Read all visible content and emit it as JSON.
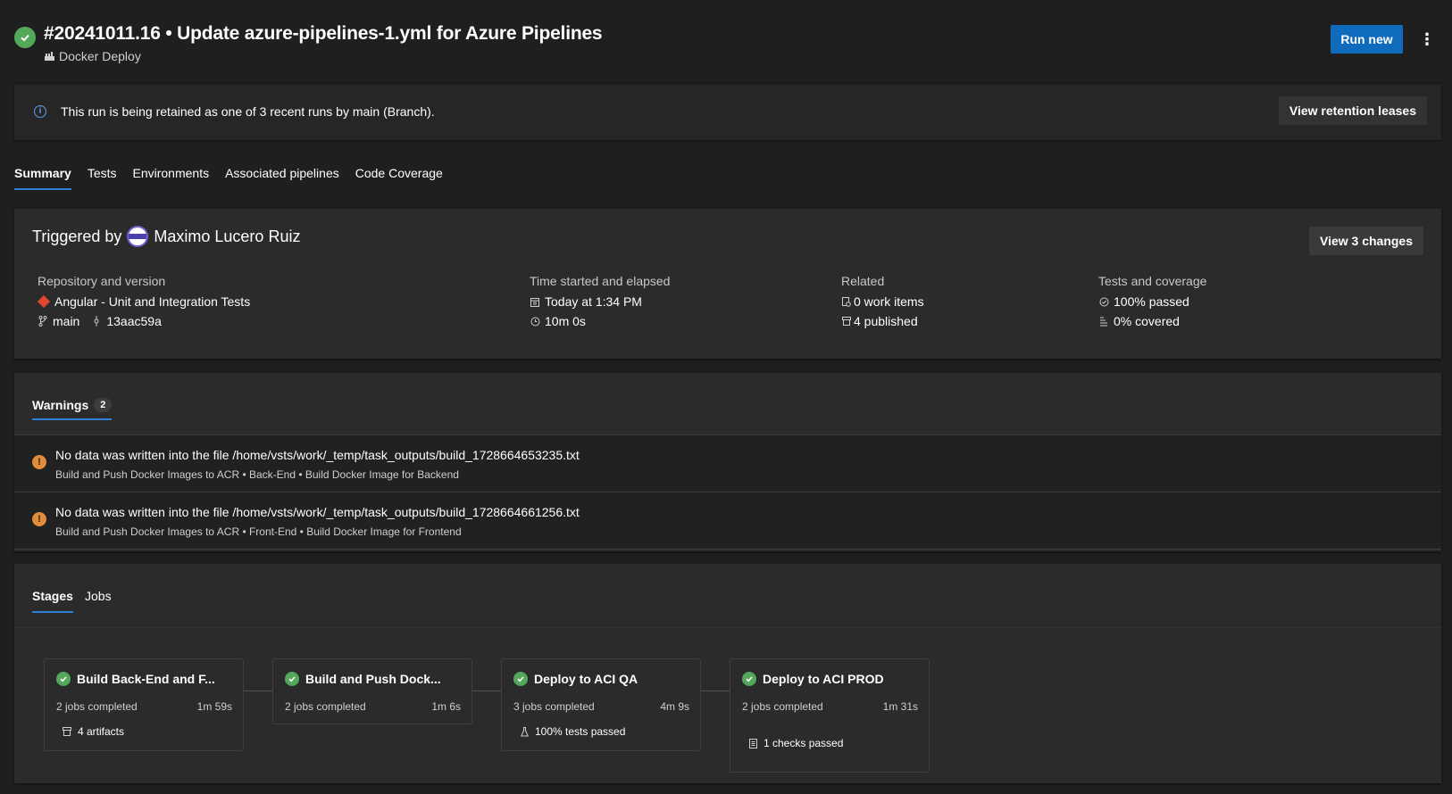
{
  "header": {
    "title": "#20241011.16 • Update azure-pipelines-1.yml for Azure Pipelines",
    "pipeline_name": "Docker Deploy",
    "run_new_label": "Run new",
    "more_label": "⋮"
  },
  "banner": {
    "info_glyph": "i",
    "text": "This run is being retained as one of 3 recent runs by main (Branch).",
    "button_label": "View retention leases"
  },
  "tabs": [
    "Summary",
    "Tests",
    "Environments",
    "Associated pipelines",
    "Code Coverage"
  ],
  "summary": {
    "triggered_by_label": "Triggered by",
    "user_name": "Maximo Lucero Ruiz",
    "view_changes_label": "View 3 changes",
    "repository": {
      "header": "Repository and version",
      "repo_name": "Angular - Unit and Integration Tests",
      "branch": "main",
      "commit": "13aac59a"
    },
    "time": {
      "header": "Time started and elapsed",
      "started": "Today at 1:34 PM",
      "elapsed": "10m 0s"
    },
    "related": {
      "header": "Related",
      "work_items": "0 work items",
      "published": "4 published"
    },
    "tests": {
      "header": "Tests and coverage",
      "passed": "100% passed",
      "covered": "0% covered"
    }
  },
  "warnings": {
    "tab_label": "Warnings",
    "count": "2",
    "items": [
      {
        "message": "No data was written into the file /home/vsts/work/_temp/task_outputs/build_1728664653235.txt",
        "path": "Build and Push Docker Images to ACR • Back-End • Build Docker Image for Backend"
      },
      {
        "message": "No data was written into the file /home/vsts/work/_temp/task_outputs/build_1728664661256.txt",
        "path": "Build and Push Docker Images to ACR • Front-End • Build Docker Image for Frontend"
      }
    ]
  },
  "stages_section": {
    "tabs": [
      "Stages",
      "Jobs"
    ],
    "stages": [
      {
        "name": "Build Back-End and F...",
        "jobs": "2 jobs completed",
        "duration": "1m 59s",
        "extra": "4 artifacts"
      },
      {
        "name": "Build and Push Dock...",
        "jobs": "2 jobs completed",
        "duration": "1m 6s",
        "extra": ""
      },
      {
        "name": "Deploy to ACI QA",
        "jobs": "3 jobs completed",
        "duration": "4m 9s",
        "extra": "100% tests passed"
      },
      {
        "name": "Deploy to ACI PROD",
        "jobs": "2 jobs completed",
        "duration": "1m 31s",
        "extra": "1 checks passed"
      }
    ]
  },
  "colors": {
    "background": "#1f1f1f",
    "primary_button": "#0f6cbd",
    "success": "#54a85a",
    "warning": "#e08c3b",
    "tab_underline": "#2f7ed8"
  }
}
